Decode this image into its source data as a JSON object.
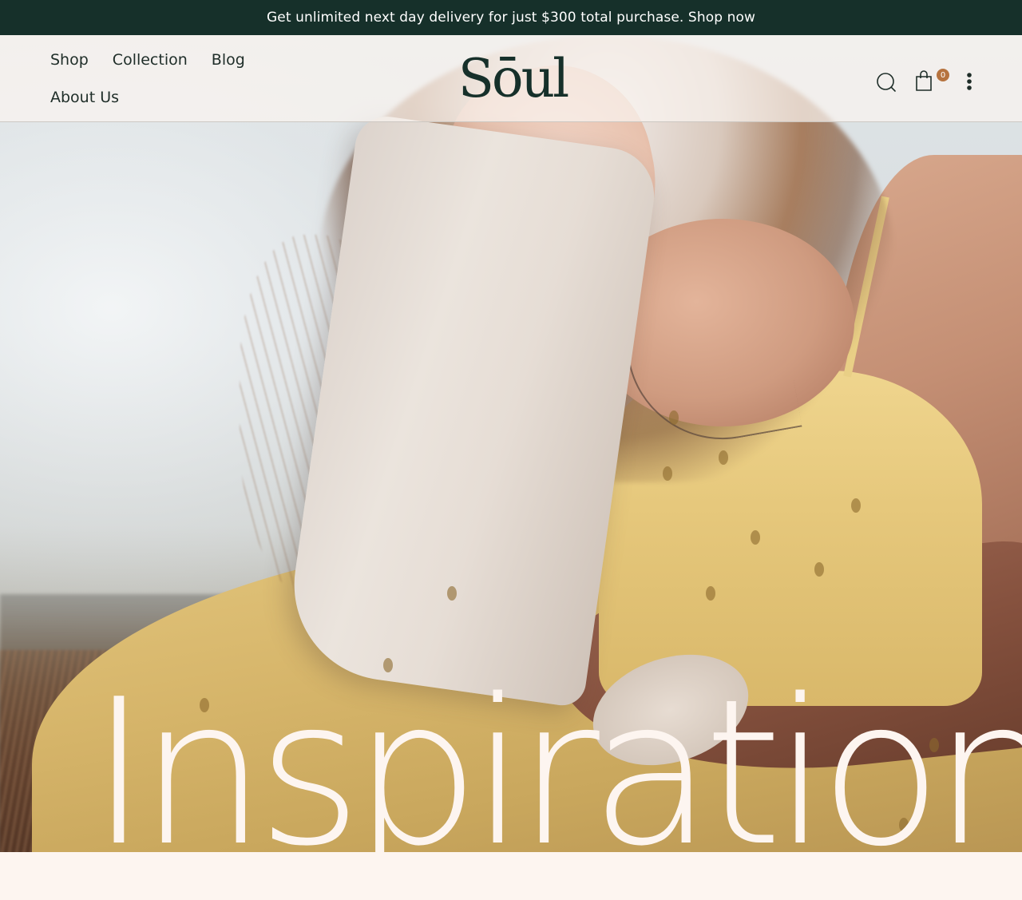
{
  "announcement": {
    "text": "Get unlimited next day delivery for just $300 total purchase. Shop now"
  },
  "header": {
    "nav": [
      {
        "label": "Shop"
      },
      {
        "label": "Collection"
      },
      {
        "label": "Blog"
      },
      {
        "label": "About Us"
      }
    ],
    "logo": "Sōul",
    "icons": {
      "search": "search-icon",
      "cart": "shopping-bag-icon",
      "more": "more-vertical-icon"
    },
    "cart_count": "0"
  },
  "hero": {
    "headline": "Inspiration",
    "image": "woman-in-yellow-dress-resting-on-pillow"
  },
  "colors": {
    "announcement_bg": "#16302a",
    "text_dark": "#1e2d28",
    "badge": "#b6733f",
    "page_bg": "#fdf5f0"
  }
}
